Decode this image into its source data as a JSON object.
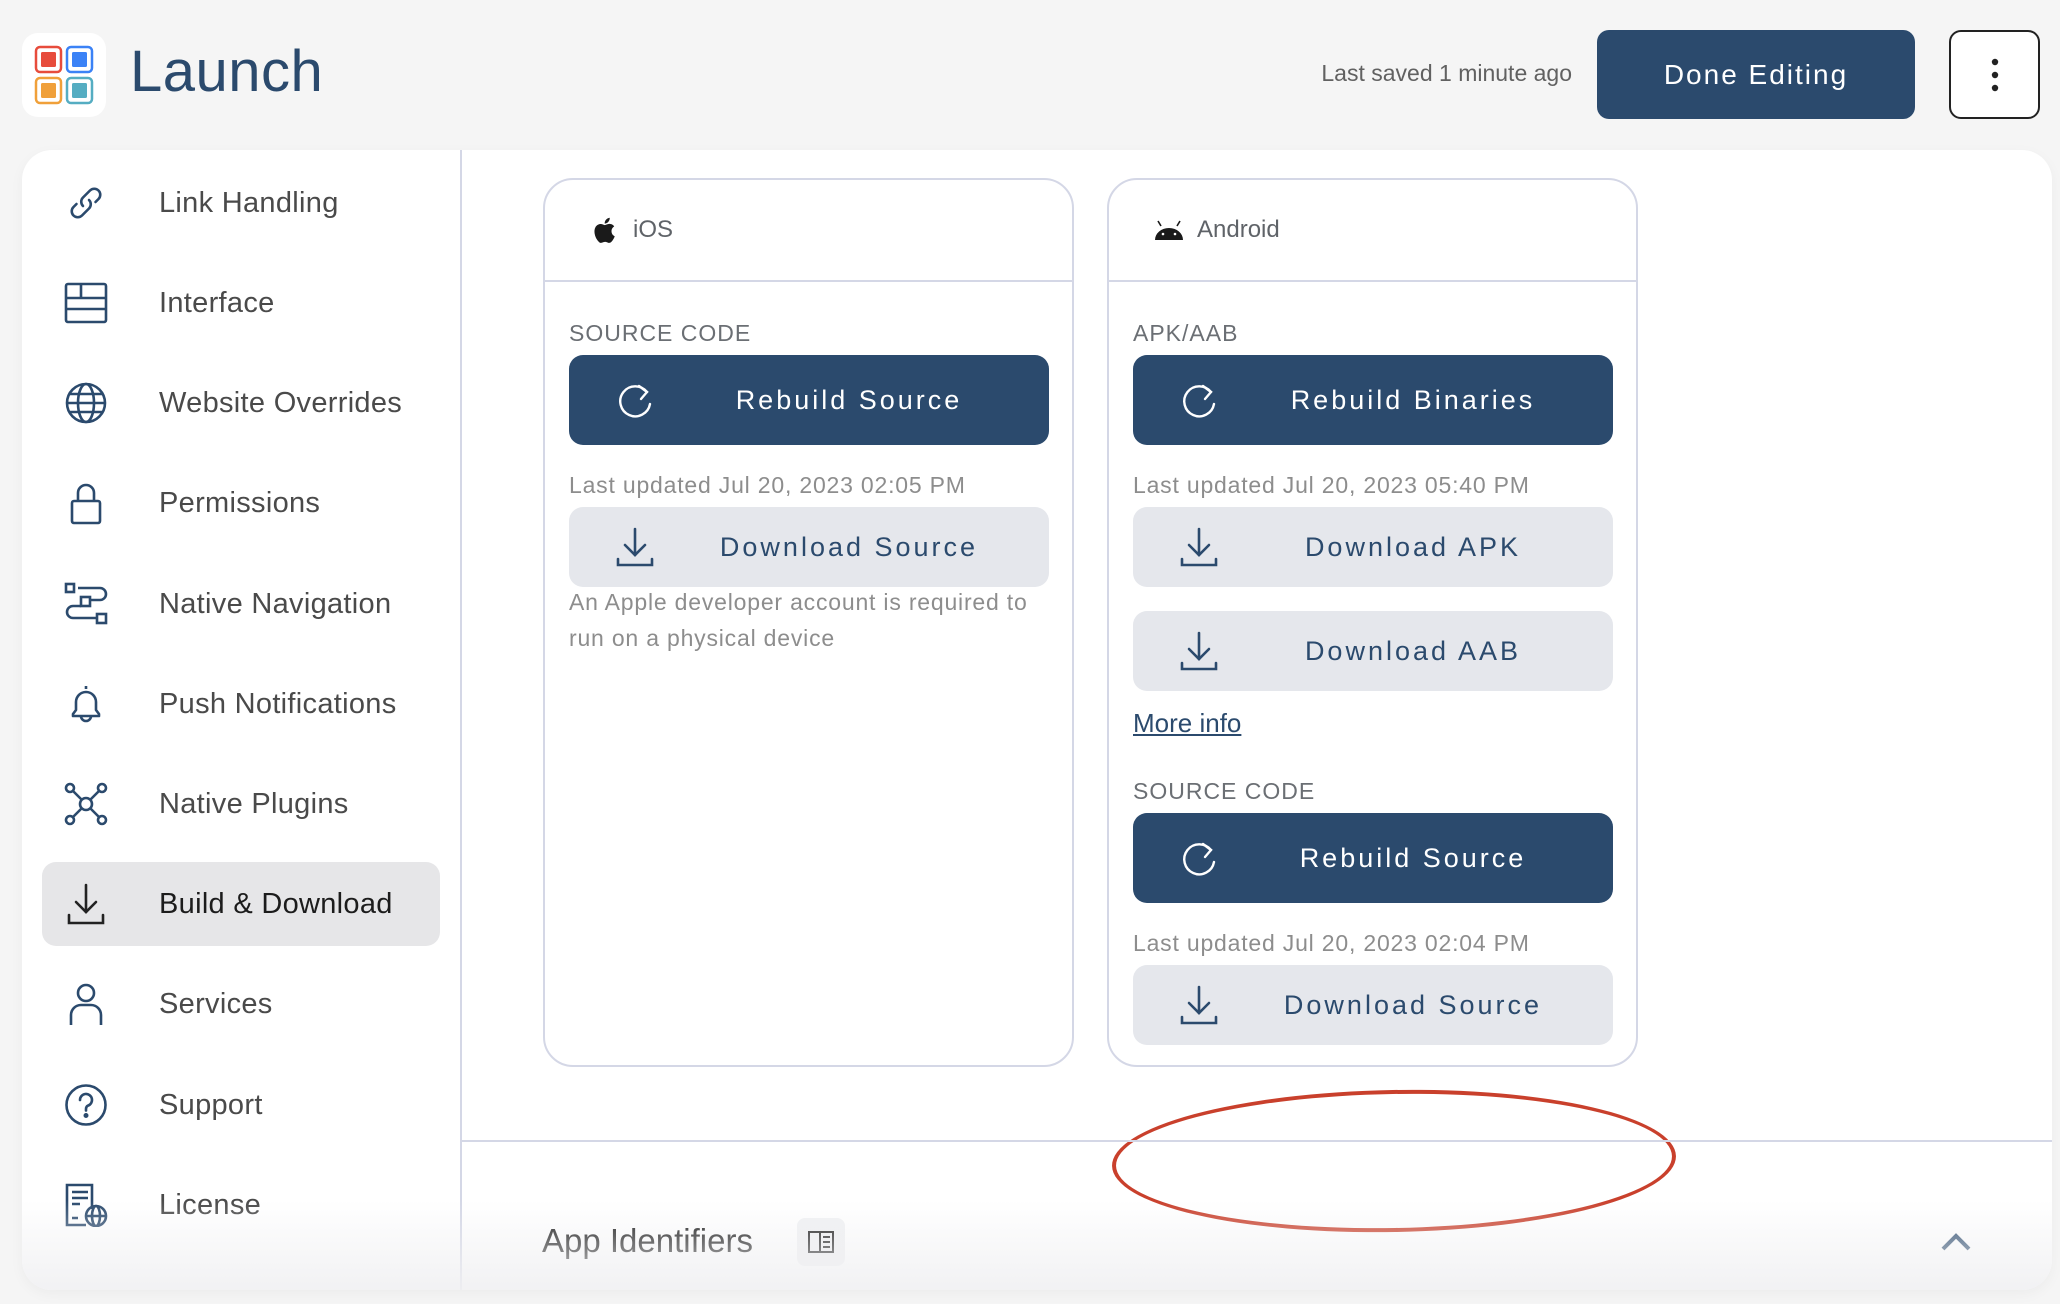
{
  "header": {
    "app_title": "Launch",
    "last_saved": "Last saved 1 minute ago",
    "done_button": "Done Editing",
    "more_menu_icon": "kebab-icon"
  },
  "sidebar": {
    "items": [
      {
        "label": "Link Handling",
        "icon": "link-icon",
        "active": false
      },
      {
        "label": "Interface",
        "icon": "layout-icon",
        "active": false
      },
      {
        "label": "Website Overrides",
        "icon": "globe-icon",
        "active": false
      },
      {
        "label": "Permissions",
        "icon": "lock-icon",
        "active": false
      },
      {
        "label": "Native Navigation",
        "icon": "navigation-flow-icon",
        "active": false
      },
      {
        "label": "Push Notifications",
        "icon": "bell-icon",
        "active": false
      },
      {
        "label": "Native Plugins",
        "icon": "plugins-icon",
        "active": false
      },
      {
        "label": "Build & Download",
        "icon": "download-icon",
        "active": true
      },
      {
        "label": "Services",
        "icon": "user-icon",
        "active": false
      },
      {
        "label": "Support",
        "icon": "help-icon",
        "active": false
      },
      {
        "label": "License",
        "icon": "license-icon",
        "active": false
      }
    ]
  },
  "ios": {
    "platform": "iOS",
    "source_label": "SOURCE CODE",
    "rebuild_source": "Rebuild Source",
    "source_updated": "Last updated Jul 20, 2023 02:05 PM",
    "download_source": "Download Source",
    "note": "An Apple developer account is required to run on a physical device"
  },
  "android": {
    "platform": "Android",
    "binaries_label": "APK/AAB",
    "rebuild_binaries": "Rebuild Binaries",
    "binaries_updated": "Last updated Jul 20, 2023 05:40 PM",
    "download_apk": "Download APK",
    "download_aab": "Download AAB",
    "more_info": "More info",
    "source_label": "SOURCE CODE",
    "rebuild_source": "Rebuild Source",
    "source_updated": "Last updated Jul 20, 2023 02:04 PM",
    "download_source": "Download Source"
  },
  "section": {
    "title": "App Identifiers"
  },
  "colors": {
    "brand": "#2b4a6d",
    "secondary_button": "#e5e7ec",
    "border": "#d4d7e6",
    "annotation": "#c9402c",
    "active_nav": "#e6e6e8"
  }
}
